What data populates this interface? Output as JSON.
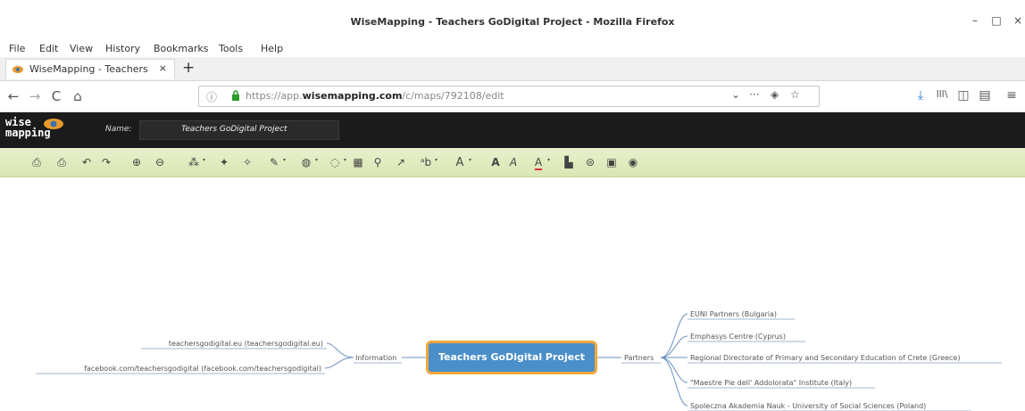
{
  "window": {
    "title": "WiseMapping - Teachers GoDigital Project - Mozilla Firefox",
    "minimize": "–",
    "maximize": "□",
    "close": "×"
  },
  "menu": {
    "items": [
      "File",
      "Edit",
      "View",
      "History",
      "Bookmarks",
      "Tools",
      "Help"
    ]
  },
  "tabs": [
    {
      "label": "WiseMapping - Teachers",
      "close": "×",
      "favicon": "wisemapping-favicon"
    }
  ],
  "new_tab": "+",
  "nav": {
    "back": "←",
    "forward": "→",
    "reload": "C",
    "home": "⌂",
    "url_prefix": "https://app.",
    "url_host": "wisemapping.com",
    "url_path": "/c/maps/792108/edit",
    "dropdown": "⌄",
    "more": "···",
    "pocket": "◈",
    "bookmark": "☆",
    "download": "⤓",
    "library": "lll\\",
    "sidebar": "◫",
    "reader": "▤",
    "menu": "≡"
  },
  "app": {
    "logo": "wise mapping",
    "name_label": "Name:",
    "map_name": "Teachers GoDigital Project"
  },
  "toolbar": {
    "tools": [
      {
        "name": "save-icon",
        "glyph": "⎙"
      },
      {
        "name": "print-icon",
        "glyph": "⎙"
      },
      {
        "name": "undo-icon",
        "glyph": "↶"
      },
      {
        "name": "redo-icon",
        "glyph": "↷"
      },
      {
        "name": "zoom-in-icon",
        "glyph": "⊕"
      },
      {
        "name": "zoom-out-icon",
        "glyph": "⊖"
      },
      {
        "name": "add-topic-icon",
        "glyph": "⁂"
      },
      {
        "name": "add-subtopic-icon",
        "glyph": "✦"
      },
      {
        "name": "delete-topic-icon",
        "glyph": "✧"
      },
      {
        "name": "topic-color-icon",
        "glyph": "✎"
      },
      {
        "name": "topic-shape-icon",
        "glyph": "◍"
      },
      {
        "name": "topic-border-icon",
        "glyph": "◌"
      },
      {
        "name": "topic-icon-icon",
        "glyph": "▦"
      },
      {
        "name": "link-icon",
        "glyph": "⚲"
      },
      {
        "name": "relationship-icon",
        "glyph": "↗"
      },
      {
        "name": "font-family-icon",
        "glyph": "ᵃb"
      },
      {
        "name": "font-size-icon",
        "glyph": "A"
      },
      {
        "name": "font-bold-icon",
        "glyph": "A"
      },
      {
        "name": "font-italic-icon",
        "glyph": "A"
      },
      {
        "name": "font-color-icon",
        "glyph": "A"
      },
      {
        "name": "history-icon",
        "glyph": "▙"
      },
      {
        "name": "share-icon",
        "glyph": "⊜"
      },
      {
        "name": "publish-icon",
        "glyph": "▣"
      },
      {
        "name": "account-icon",
        "glyph": "◉"
      }
    ]
  },
  "mindmap": {
    "central": "Teachers GoDigital Project",
    "left_branch": {
      "label": "Information",
      "children": [
        "teachersgodigital.eu (teachersgodigital.eu)",
        "facebook.com/teachersgodigital (facebook.com/teachersgodigital)"
      ]
    },
    "right_branch": {
      "label": "Partners",
      "children": [
        "EUNI Partners (Bulgaria)",
        "Emphasys Centre (Cyprus)",
        "Regional Directorate of Primary and Secondary Education of Crete (Greece)",
        "\"Maestre Pie dell' Addolorata\" Institute (Italy)",
        "Spoleczna Akademia Nauk - University of Social Sciences (Poland)"
      ]
    }
  },
  "colors": {
    "central_fill": "#4a8fc9",
    "central_border": "#f0a83c",
    "toolbar_bg": "#dfe9bd",
    "header_bg": "#1b1b1b"
  }
}
